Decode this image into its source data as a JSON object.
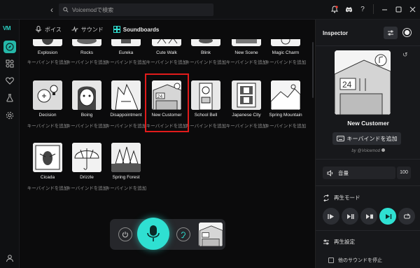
{
  "titlebar": {
    "search_placeholder": "Voicemodで検索",
    "icons": [
      "bell-icon",
      "discord-icon",
      "help-icon",
      "minimize-icon",
      "maximize-icon",
      "close-icon"
    ],
    "help_glyph": "?"
  },
  "rail": {
    "logo": "VM",
    "items": [
      "compass-icon",
      "sound-effects-icon",
      "heart-icon",
      "flask-icon",
      "settings-icon"
    ],
    "user_icon": "user-icon"
  },
  "tabs": [
    {
      "label": "ボイス",
      "icon": "voice-icon",
      "active": false
    },
    {
      "label": "サウンド",
      "icon": "sound-icon",
      "active": false
    },
    {
      "label": "Soundboards",
      "icon": "soundboards-icon",
      "active": true
    }
  ],
  "keybind_label": "キーバインドを追加",
  "sounds_row0": [
    {
      "name": "Explosion"
    },
    {
      "name": "Rocks"
    },
    {
      "name": "Eureka"
    },
    {
      "name": "Cute Walk"
    },
    {
      "name": "Blink"
    },
    {
      "name": "New Scene"
    },
    {
      "name": "Magic Charm"
    }
  ],
  "sounds_row1": [
    {
      "name": "Decision"
    },
    {
      "name": "Boing"
    },
    {
      "name": "Disappointment"
    },
    {
      "name": "New Customer"
    },
    {
      "name": "School Bell"
    },
    {
      "name": "Japanese City"
    },
    {
      "name": "Spring Mountain"
    }
  ],
  "sounds_row2": [
    {
      "name": "Cicada"
    },
    {
      "name": "Drizzle"
    },
    {
      "name": "Spring Forest"
    }
  ],
  "inspector": {
    "title": "Inspector",
    "sound_name": "New Customer",
    "keybind_button": "キーバインドを追加",
    "credit": "by @Voicemod",
    "thumb_number": "24",
    "volume_label": "音量",
    "volume_value": "100",
    "playback_mode_label": "再生モード",
    "playback_settings_label": "再生設定",
    "stop_other_label": "他のサウンドを停止",
    "active_mode_index": 3
  },
  "colors": {
    "accent": "#2fe0d2",
    "highlight": "#e11b1b",
    "background": "#0b0b0c"
  }
}
